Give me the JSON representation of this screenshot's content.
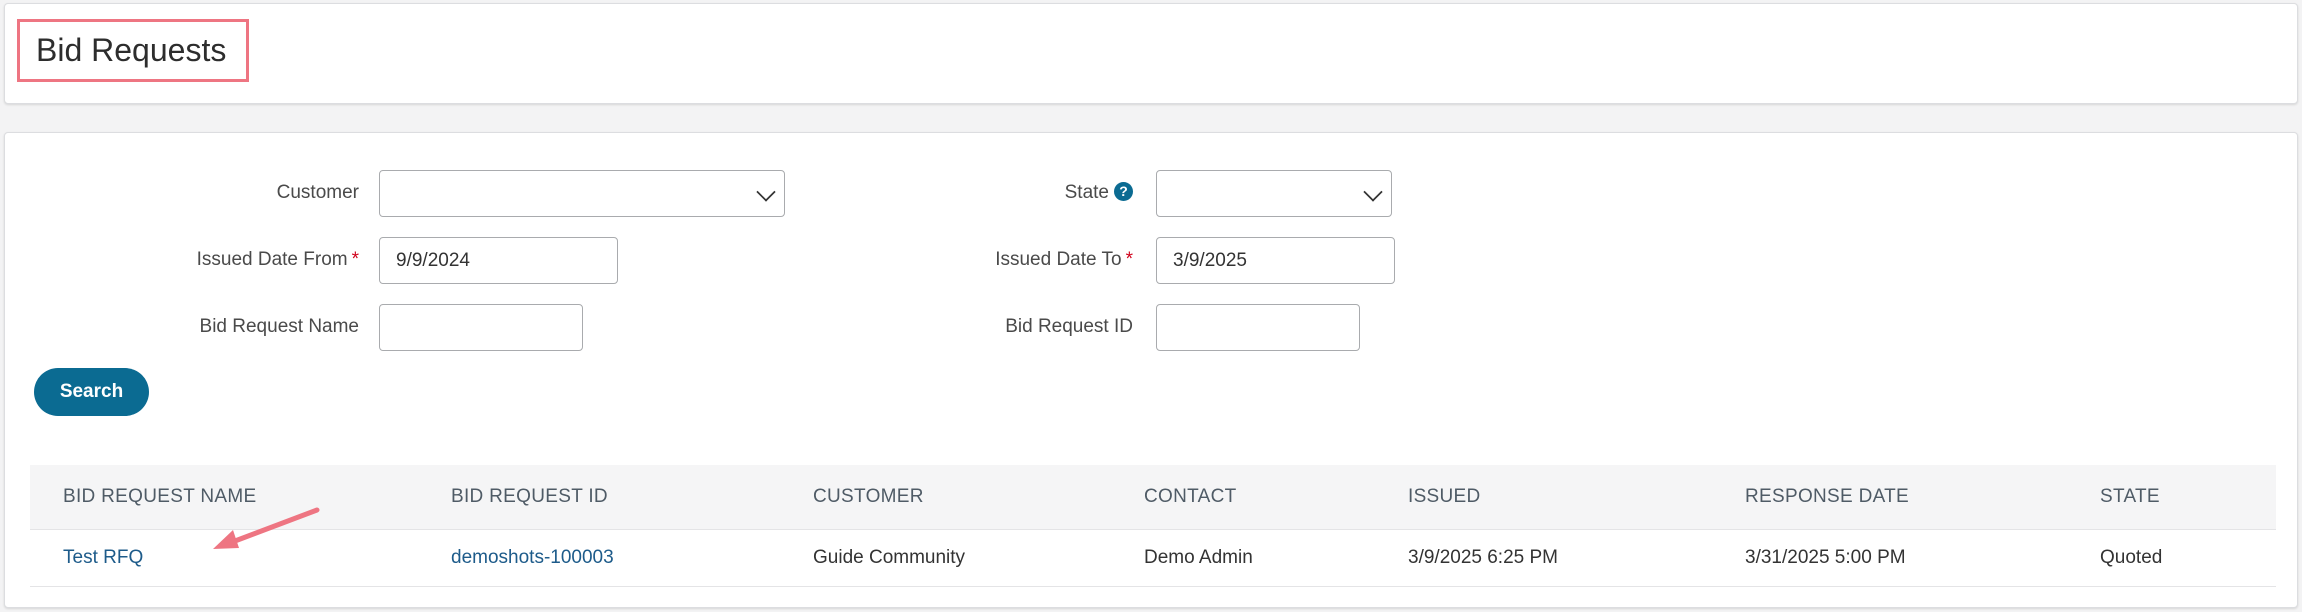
{
  "header": {
    "title": "Bid Requests"
  },
  "filters": {
    "customer": {
      "label": "Customer",
      "value": ""
    },
    "state": {
      "label": "State",
      "value": "",
      "help": "?"
    },
    "issued_from": {
      "label": "Issued Date From",
      "required": "*",
      "value": "9/9/2024"
    },
    "issued_to": {
      "label": "Issued Date To",
      "required": "*",
      "value": "3/9/2025"
    },
    "bid_request_name": {
      "label": "Bid Request Name",
      "value": ""
    },
    "bid_request_id": {
      "label": "Bid Request ID",
      "value": ""
    },
    "search_label": "Search"
  },
  "table": {
    "columns": [
      "BID REQUEST NAME",
      "BID REQUEST ID",
      "CUSTOMER",
      "CONTACT",
      "ISSUED",
      "RESPONSE DATE",
      "STATE"
    ],
    "rows": [
      [
        "Test RFQ",
        "demoshots-100003",
        "Guide Community",
        "Demo Admin",
        "3/9/2025 6:25 PM",
        "3/31/2025 5:00 PM",
        "Quoted"
      ]
    ]
  },
  "colors": {
    "accent": "#0b6b92",
    "link": "#1d5b8a",
    "highlight": "#ee7582",
    "required": "#d0021b"
  }
}
